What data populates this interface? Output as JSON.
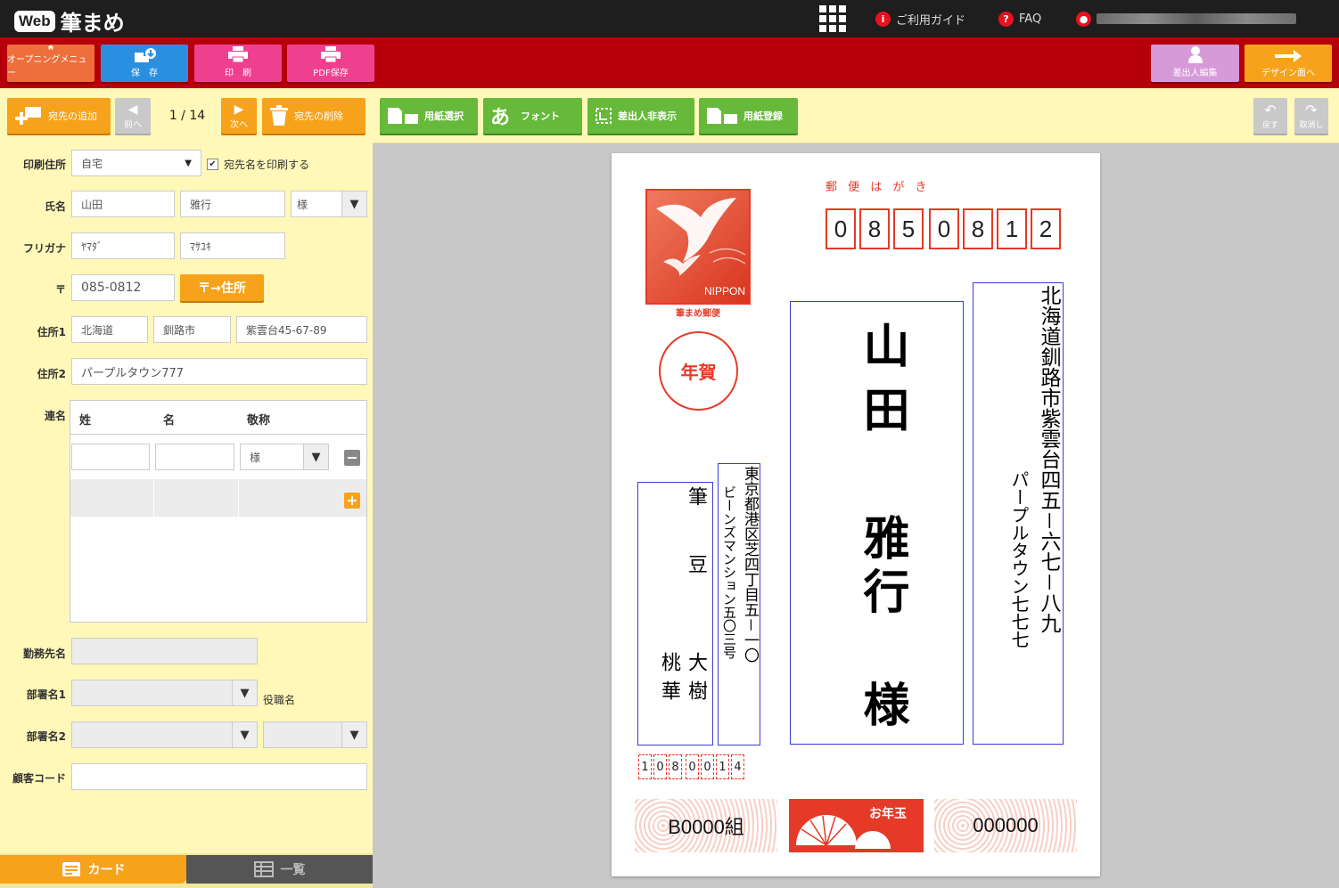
{
  "app": {
    "logo_web": "Web",
    "logo_name": "筆まめ",
    "guide": "ご利用ガイド",
    "faq": "FAQ"
  },
  "toolbar": {
    "opening": "オープニングメニュー",
    "save": "保　存",
    "print": "印　刷",
    "pdf": "PDF保存",
    "sender_edit": "差出人編集",
    "design": "デザイン面へ"
  },
  "addr_toolbar": {
    "add": "宛先の追加",
    "prev": "前へ",
    "page": "1 / 14",
    "next": "次へ",
    "delete": "宛先の削除"
  },
  "paper_toolbar": {
    "paper_select": "用紙選択",
    "font_icon": "あ",
    "font": "フォント",
    "hide_sender": "差出人非表示",
    "paper_register": "用紙登録",
    "undo": "戻す",
    "redo": "取消し"
  },
  "form": {
    "print_addr_label": "印刷住所",
    "print_addr_value": "自宅",
    "print_name_check": "宛先名を印刷する",
    "name_label": "氏名",
    "last": "山田",
    "first": "雅行",
    "honorific": "様",
    "kana_label": "フリガナ",
    "last_kana": "ﾔﾏﾀﾞ",
    "first_kana": "ﾏｻﾕｷ",
    "zip_label": "〒",
    "zip": "085-0812",
    "zip_btn": "〒→住所",
    "addr1_label": "住所1",
    "pref": "北海道",
    "city": "釧路市",
    "street": "紫雲台45-67-89",
    "addr2_label": "住所2",
    "addr2": "パープルタウン777",
    "joint_label": "連名",
    "col_last": "姓",
    "col_first": "名",
    "col_honor": "敬称",
    "joint_honor": "様",
    "company_label": "勤務先名",
    "dept1_label": "部署名1",
    "title_label": "役職名",
    "dept2_label": "部署名2",
    "customer_label": "顧客コード"
  },
  "tabs": {
    "card": "カード",
    "list": "一覧"
  },
  "postcard": {
    "header": "郵 便 は が き",
    "zip_digits": [
      "0",
      "8",
      "5",
      "0",
      "8",
      "1",
      "2"
    ],
    "stamp_label": "NIPPON",
    "stamp_caption": "筆まめ郵便",
    "nenga": "年賀",
    "recipient": [
      "山田",
      "雅行",
      "様"
    ],
    "address_main": "北海道釧路市紫雲台四五－六七－八九",
    "address_sub": "パープルタウン七七七",
    "sender_addr_main": "東京都港区芝四丁目五－一〇",
    "sender_addr_sub": "ビーンズマンション五〇三号",
    "sender_name_top": "筆",
    "sender_name_mid": "豆",
    "sender_name1": "大樹",
    "sender_name2": "桃華",
    "sender_zip": [
      "1",
      "0",
      "8",
      "0",
      "0",
      "1",
      "4"
    ],
    "lottery_left": "B0000組",
    "otoshidama": "お年玉",
    "lottery_right": "000000"
  },
  "colors": {
    "topbar": "#1e1e1e",
    "redbar": "#b5000a",
    "orange": "#f7a21b",
    "green": "#66b93a",
    "panel": "#fff8b8",
    "postal_red": "#e53a28"
  }
}
